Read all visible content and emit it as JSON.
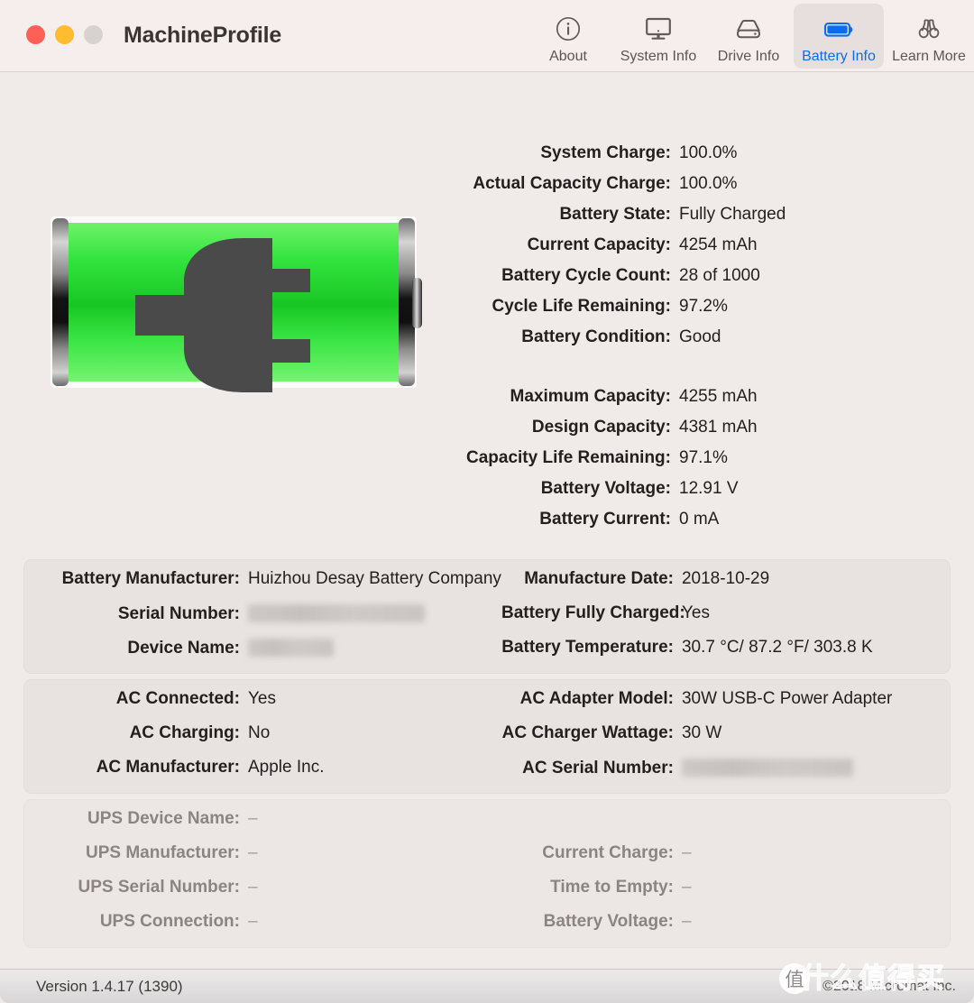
{
  "window": {
    "title": "MachineProfile",
    "traffic_lights": [
      "close",
      "minimize",
      "zoom"
    ]
  },
  "toolbar": {
    "items": [
      {
        "label": "About",
        "icon": "info-circle-icon",
        "selected": false
      },
      {
        "label": "System Info",
        "icon": "desktop-icon",
        "selected": false
      },
      {
        "label": "Drive Info",
        "icon": "hard-drive-icon",
        "selected": false
      },
      {
        "label": "Battery Info",
        "icon": "battery-icon",
        "selected": true
      },
      {
        "label": "Learn More",
        "icon": "binoculars-icon",
        "selected": false
      }
    ],
    "accent_color": "#0a6cf0"
  },
  "battery_graphic": {
    "icon": "battery-charging-plug-icon",
    "fill_color": "#36e048",
    "fill_percent": 100,
    "plug_color": "#4a4a4a"
  },
  "summary": {
    "group_a": [
      {
        "label": "System Charge:",
        "value": "100.0%"
      },
      {
        "label": "Actual Capacity Charge:",
        "value": "100.0%"
      },
      {
        "label": "Battery State:",
        "value": "Fully Charged"
      },
      {
        "label": "Current Capacity:",
        "value": "4254 mAh"
      },
      {
        "label": "Battery Cycle Count:",
        "value": "28 of 1000"
      },
      {
        "label": "Cycle Life Remaining:",
        "value": "97.2%"
      },
      {
        "label": "Battery Condition:",
        "value": "Good"
      }
    ],
    "group_b": [
      {
        "label": "Maximum Capacity:",
        "value": "4255 mAh"
      },
      {
        "label": "Design Capacity:",
        "value": "4381 mAh"
      },
      {
        "label": "Capacity Life Remaining:",
        "value": "97.1%"
      },
      {
        "label": "Battery Voltage:",
        "value": "12.91 V"
      },
      {
        "label": "Battery Current:",
        "value": "0 mA"
      }
    ]
  },
  "battery_panel": {
    "left": [
      {
        "label": "Battery Manufacturer:",
        "value": "Huizhou Desay Battery Company",
        "redacted": false
      },
      {
        "label": "Serial Number:",
        "value": "",
        "redacted": true
      },
      {
        "label": "Device Name:",
        "value": "",
        "redacted": true
      }
    ],
    "right": [
      {
        "label": "Manufacture Date:",
        "value": "2018-10-29",
        "redacted": false
      },
      {
        "label": "Battery Fully Charged:",
        "value": "Yes",
        "redacted": false
      },
      {
        "label": "Battery Temperature:",
        "value": "30.7 °C/ 87.2 °F/ 303.8 K",
        "redacted": false
      }
    ]
  },
  "ac_panel": {
    "left": [
      {
        "label": "AC Connected:",
        "value": "Yes",
        "redacted": false
      },
      {
        "label": "AC Charging:",
        "value": "No",
        "redacted": false
      },
      {
        "label": "AC Manufacturer:",
        "value": "Apple Inc.",
        "redacted": false
      }
    ],
    "right": [
      {
        "label": "AC Adapter Model:",
        "value": "30W USB-C Power Adapter",
        "redacted": false
      },
      {
        "label": "AC Charger Wattage:",
        "value": "30 W",
        "redacted": false
      },
      {
        "label": "AC Serial Number:",
        "value": "",
        "redacted": true
      }
    ]
  },
  "ups_panel": {
    "disabled": true,
    "left": [
      {
        "label": "UPS Device Name:",
        "value": "–"
      },
      {
        "label": "UPS Manufacturer:",
        "value": "–"
      },
      {
        "label": "UPS Serial Number:",
        "value": "–"
      },
      {
        "label": "UPS Connection:",
        "value": "–"
      }
    ],
    "right": [
      {
        "label": "Current Charge:",
        "value": "–"
      },
      {
        "label": "Time to Empty:",
        "value": "–"
      },
      {
        "label": "Battery Voltage:",
        "value": "–"
      }
    ]
  },
  "footer": {
    "version": "Version 1.4.17 (1390)",
    "copyright": "©2018 Micromat Inc."
  },
  "watermark": {
    "logo_char": "值",
    "text": "什么值得买"
  }
}
